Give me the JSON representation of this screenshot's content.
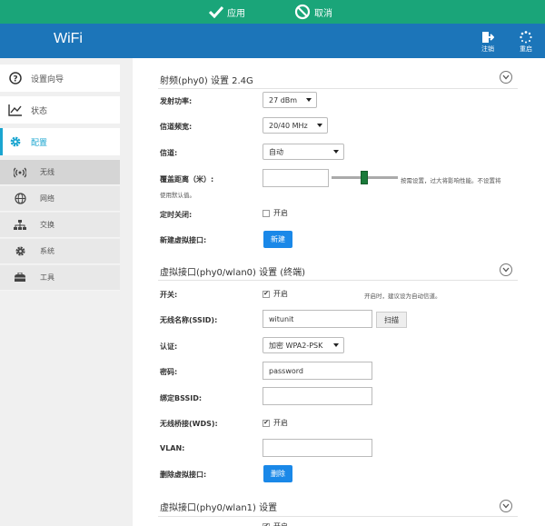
{
  "actionbar": {
    "apply_label": "应用",
    "cancel_label": "取消"
  },
  "header": {
    "brand": "WiFi",
    "logout_label": "注销",
    "reboot_label": "重启"
  },
  "sidebar": {
    "items": [
      {
        "label": "设置向导",
        "icon": "question-icon"
      },
      {
        "label": "状态",
        "icon": "chart-icon"
      },
      {
        "label": "配置",
        "icon": "gear-icon"
      }
    ],
    "subitems": [
      {
        "label": "无线",
        "icon": "wifi-icon"
      },
      {
        "label": "网络",
        "icon": "globe-icon"
      },
      {
        "label": "交换",
        "icon": "sitemap-icon"
      },
      {
        "label": "系统",
        "icon": "gear-icon"
      },
      {
        "label": "工具",
        "icon": "toolbox-icon"
      }
    ]
  },
  "radio": {
    "title": "射频(phy0) 设置 2.4G",
    "tx_power_label": "发射功率:",
    "tx_power_value": "27 dBm",
    "bandwidth_label": "信道频宽:",
    "bandwidth_value": "20/40 MHz",
    "channel_label": "信道:",
    "channel_value": "自动",
    "coverage_label": "覆盖距离（米）:",
    "coverage_value": "",
    "coverage_hint": "按需设置，过大将影响性能。不设置将",
    "coverage_hint2": "使用默认值。",
    "timer_off_label": "定时关闭:",
    "timer_off_option": "开启",
    "timer_off_checked": false,
    "new_vif_label": "新建虚拟接口:",
    "new_button": "新建"
  },
  "wlan0": {
    "title": "虚拟接口(phy0/wlan0) 设置 (终端)",
    "switch_label": "开关:",
    "switch_option": "开启",
    "switch_checked": true,
    "switch_hint": "开启时，建议设为自动信道。",
    "ssid_label": "无线名称(SSID):",
    "ssid_value": "witunit",
    "scan_button": "扫描",
    "auth_label": "认证:",
    "auth_value": "加密 WPA2-PSK",
    "password_label": "密码:",
    "password_value": "password",
    "bssid_label": "绑定BSSID:",
    "bssid_value": "",
    "wds_label": "无线桥接(WDS):",
    "wds_option": "开启",
    "wds_checked": true,
    "vlan_label": "VLAN:",
    "vlan_value": "",
    "delete_vif_label": "删除虚拟接口:",
    "delete_button": "删除"
  },
  "wlan1": {
    "title": "虚拟接口(phy0/wlan1) 设置",
    "switch_option": "开启"
  },
  "colors": {
    "actionbar": "#1aa579",
    "header": "#1c75b9",
    "active": "#1aa5d0",
    "button": "#1a88e8"
  }
}
